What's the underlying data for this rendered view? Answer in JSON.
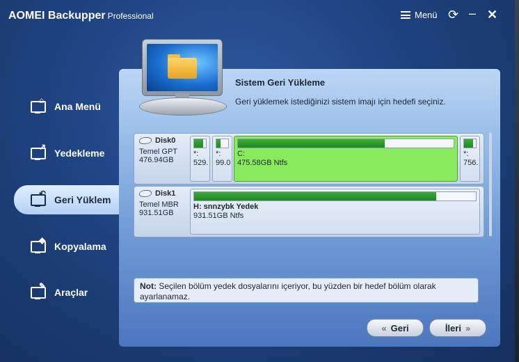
{
  "window": {
    "title": "AOMEI Backupper",
    "edition": "Professional",
    "menu_label": "Menü"
  },
  "sidebar": {
    "items": [
      {
        "label": "Ana Menü",
        "icon": "home-monitor-icon"
      },
      {
        "label": "Yedekleme",
        "icon": "backup-monitor-icon"
      },
      {
        "label": "Geri Yüklem",
        "icon": "restore-monitor-icon",
        "active": true
      },
      {
        "label": "Kopyalama",
        "icon": "clone-monitor-icon"
      },
      {
        "label": "Araçlar",
        "icon": "tools-monitor-icon"
      }
    ]
  },
  "main": {
    "heading": "Sistem Geri Yükleme",
    "subtitle": "Geri yüklemek istediğinizi sistem imajı için hedefi seçiniz.",
    "disks": [
      {
        "name": "Disk0",
        "type": "Temel GPT",
        "size": "476.94GB",
        "partitions": [
          {
            "label": "*:",
            "size": "529.",
            "used": 0.75
          },
          {
            "label": "*:",
            "size": "99.0",
            "used": 0.35
          },
          {
            "label": "C:",
            "size": "475.58GB Ntfs",
            "used": 0.68,
            "selected": true
          },
          {
            "label": "*:",
            "size": "756.",
            "used": 0.75
          }
        ]
      },
      {
        "name": "Disk1",
        "type": "Temel MBR",
        "size": "931.51GB",
        "partitions": [
          {
            "label": "H: snnzybk Yedek",
            "size": "931.51GB Ntfs",
            "used": 0.86
          }
        ]
      }
    ],
    "note_prefix": "Not:",
    "note_text": "Seçilen bölüm yedek dosyalarını içeriyor, bu yüzden bir hedef bölüm olarak ayarlanamaz.",
    "back_label": "Geri",
    "next_label": "İleri"
  }
}
